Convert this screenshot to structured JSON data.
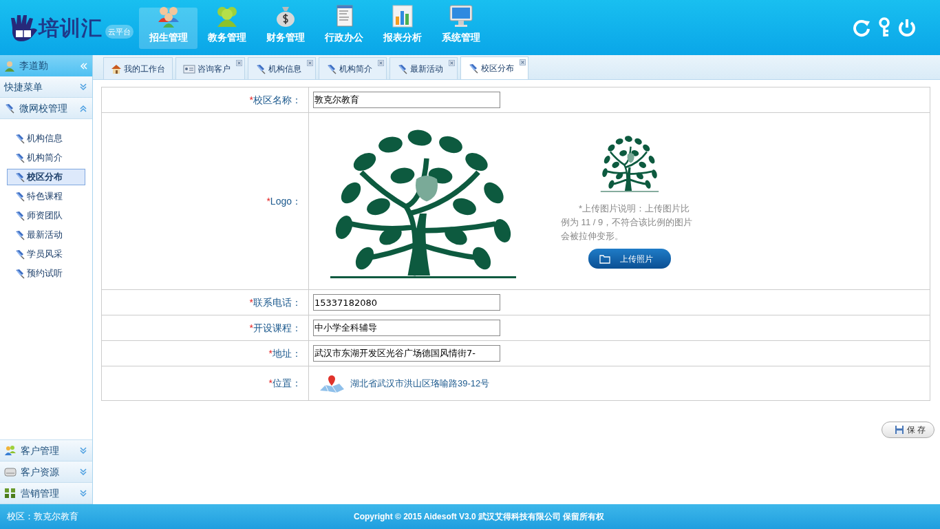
{
  "logo": {
    "text": "培训汇",
    "badge": "云平台"
  },
  "top_nav": [
    {
      "label": "招生管理",
      "selected": true
    },
    {
      "label": "教务管理",
      "selected": false
    },
    {
      "label": "财务管理",
      "selected": false
    },
    {
      "label": "行政办公",
      "selected": false
    },
    {
      "label": "报表分析",
      "selected": false
    },
    {
      "label": "系统管理",
      "selected": false
    }
  ],
  "user": {
    "name": "李道勤"
  },
  "sidebar": {
    "sections": [
      {
        "label": "快捷菜单",
        "expanded": false
      },
      {
        "label": "微网校管理",
        "expanded": true,
        "children": [
          {
            "label": "机构信息",
            "selected": false
          },
          {
            "label": "机构简介",
            "selected": false
          },
          {
            "label": "校区分布",
            "selected": true
          },
          {
            "label": "特色课程",
            "selected": false
          },
          {
            "label": "师资团队",
            "selected": false
          },
          {
            "label": "最新活动",
            "selected": false
          },
          {
            "label": "学员风采",
            "selected": false
          },
          {
            "label": "预约试听",
            "selected": false
          }
        ]
      }
    ],
    "bottom_sections": [
      {
        "label": "客户管理",
        "expanded": false
      },
      {
        "label": "客户资源",
        "expanded": false
      },
      {
        "label": "营销管理",
        "expanded": false
      }
    ]
  },
  "tabs": [
    {
      "label": "我的工作台",
      "closable": false,
      "selected": false
    },
    {
      "label": "咨询客户",
      "closable": true,
      "selected": false
    },
    {
      "label": "机构信息",
      "closable": true,
      "selected": false
    },
    {
      "label": "机构简介",
      "closable": true,
      "selected": false
    },
    {
      "label": "最新活动",
      "closable": true,
      "selected": false
    },
    {
      "label": "校区分布",
      "closable": true,
      "selected": true
    }
  ],
  "form": {
    "rows": [
      {
        "kind": "input",
        "required_mark": "*",
        "label": "校区名称：",
        "value": "敦克尔教育"
      },
      {
        "kind": "logo",
        "required_mark": "*",
        "label": "Logo：",
        "hint": "*上传图片说明：上传图片比例为 11 / 9，不符合该比例的图片会被拉伸变形。",
        "button": "上传照片"
      },
      {
        "kind": "input",
        "required_mark": "*",
        "label": "联系电话：",
        "value": "15337182080"
      },
      {
        "kind": "input",
        "required_mark": "*",
        "label": "开设课程：",
        "value": "中小学全科辅导"
      },
      {
        "kind": "input",
        "required_mark": "*",
        "label": "地址：",
        "value": "武汉市东湖开发区光谷广场德国风情街7-"
      },
      {
        "kind": "location",
        "required_mark": "*",
        "label": "位置：",
        "value": "湖北省武汉市洪山区珞喻路39-12号"
      }
    ]
  },
  "save_button": "保 存",
  "footer": {
    "campus": "校区：敦克尔教育",
    "copyright": "Copyright © 2015 Aidesoft V3.0 武汉艾得科技有限公司 保留所有权"
  }
}
